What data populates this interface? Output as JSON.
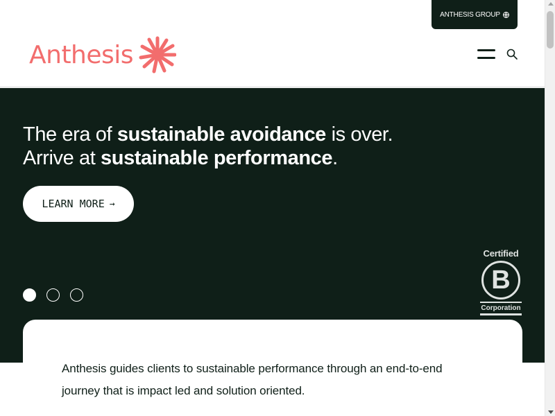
{
  "header": {
    "group_button": "ANTHESIS GROUP",
    "logo_text": "Anthesis",
    "brand_color": "#f26d6d"
  },
  "hero": {
    "line1_a": "The era of ",
    "line1_b": "sustainable avoidance",
    "line1_c": " is over.",
    "line2_a": "Arrive at ",
    "line2_b": "sustainable performance",
    "line2_c": ".",
    "cta_label": "LEARN MORE",
    "cta_arrow": "→",
    "background": "#0f1f18",
    "slides": 3,
    "active_slide": 1
  },
  "badge": {
    "top": "Certified",
    "letter": "B",
    "bottom": "Corporation"
  },
  "intro": {
    "text": "Anthesis guides clients to sustainable performance through an end-to-end journey that is impact led and solution oriented."
  },
  "icons": {
    "globe": "globe-icon",
    "menu": "hamburger-menu-icon",
    "search": "search-icon",
    "logo": "starburst-logo-icon"
  }
}
